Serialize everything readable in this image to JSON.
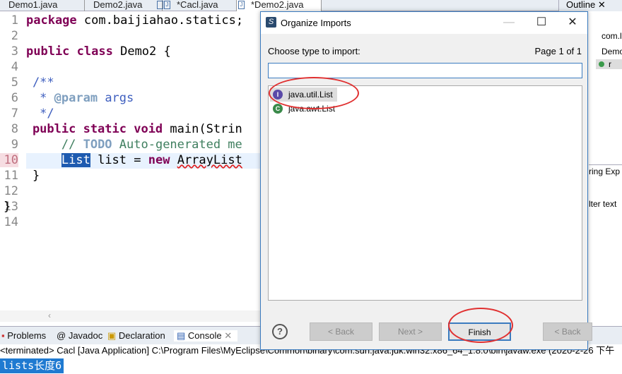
{
  "editor_tabs": [
    "Demo1.java",
    "Demo2.java",
    "*Cacl.java",
    "*Demo2.java"
  ],
  "code": {
    "line_numbers": [
      "1",
      "2",
      "3",
      "4",
      "5",
      "6",
      "7",
      "8",
      "9",
      "10",
      "11",
      "12",
      "13",
      "14"
    ],
    "l1_kw": "package",
    "l1_rest": " com.baijiahao.statics;",
    "l3_kw1": "public",
    "l3_kw2": "class",
    "l3_rest": " Demo2 {",
    "l5": "    /**",
    "l6_a": "     * ",
    "l6_tag": "@param",
    "l6_b": " args",
    "l7": "     */",
    "l8_kw": "    public static void",
    "l8_rest": " main(Strin",
    "l9_a": "        // ",
    "l9_todo": "TODO",
    "l9_b": " Auto-generated me",
    "l10_pre": "        ",
    "l10_sel": "List",
    "l10_mid": " list = ",
    "l10_kw": "new",
    "l10_err": "ArrayList",
    "l11": "    }",
    "l13": "}"
  },
  "dialog": {
    "title": "Organize Imports",
    "minimize": "—",
    "maximize": "☐",
    "close": "✕",
    "label": "Choose type to import:",
    "page": "Page 1 of 1",
    "filter_value": "",
    "items": [
      {
        "label": "java.util.List",
        "icon": "I"
      },
      {
        "label": "java.awt.List",
        "icon": "C"
      }
    ],
    "help": "?",
    "back": "< Back",
    "next": "Next >",
    "finish": "Finish",
    "back2": "< Back"
  },
  "outline": {
    "tab": "Outline",
    "items": [
      "com.l",
      "Demo",
      "r"
    ],
    "partial1": "ring Exp",
    "partial2": "lter text"
  },
  "bottom_tabs": [
    "Problems",
    "Javadoc",
    "Declaration",
    "Console"
  ],
  "console": {
    "status": "<terminated> Cacl [Java Application] C:\\Program Files\\MyEclipse\\Common\\binary\\com.sun.java.jdk.win32.x86_64_1.8.0\\bin\\javaw.exe (2020-2-26 下午",
    "output": "lists长度6"
  }
}
